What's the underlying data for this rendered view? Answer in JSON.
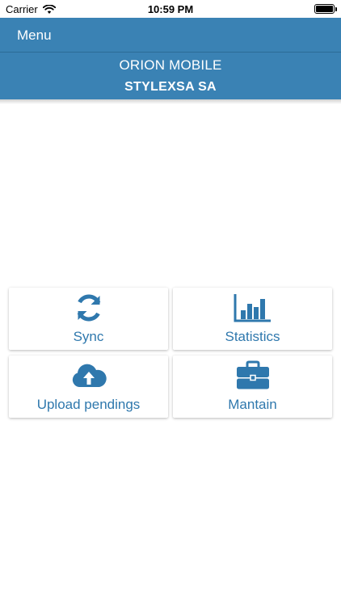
{
  "status_bar": {
    "carrier": "Carrier",
    "time": "10:59 PM"
  },
  "nav": {
    "menu_label": "Menu"
  },
  "header": {
    "app_title": "ORION MOBILE",
    "company": "STYLEXSA SA"
  },
  "tiles": [
    {
      "label": "Sync",
      "icon": "sync-icon"
    },
    {
      "label": "Statistics",
      "icon": "bar-chart-icon"
    },
    {
      "label": "Upload pendings",
      "icon": "cloud-upload-icon"
    },
    {
      "label": "Mantain",
      "icon": "briefcase-icon"
    }
  ],
  "colors": {
    "primary_blue": "#3a82b4",
    "icon_blue": "#2f78ad",
    "background": "#ffffff"
  }
}
